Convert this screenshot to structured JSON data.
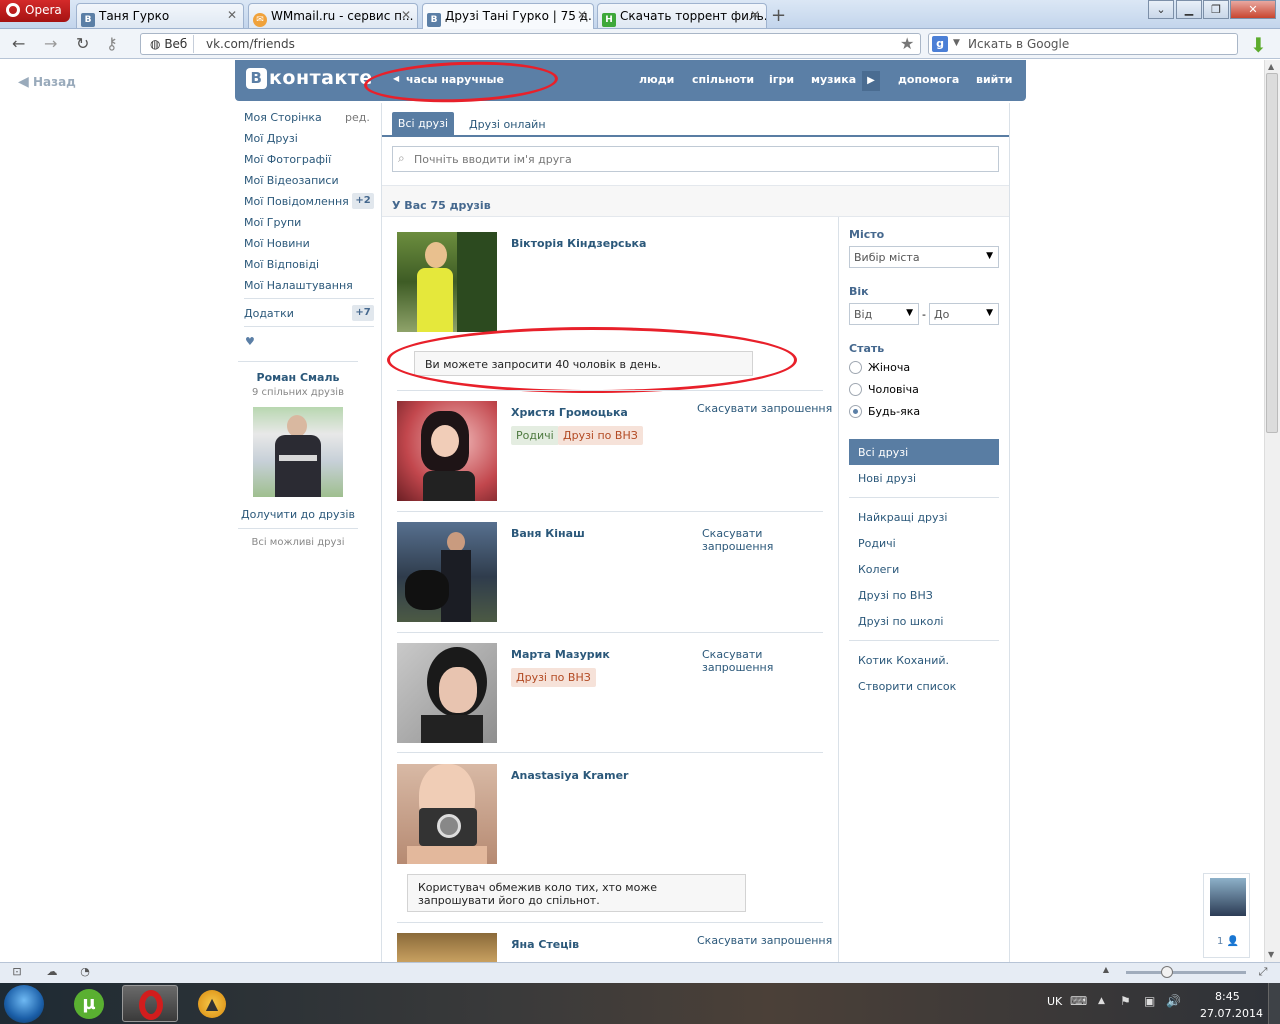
{
  "browser": {
    "menu_label": "Opera",
    "tabs": [
      {
        "title": "Таня Гурко",
        "favicon": "В"
      },
      {
        "title": "WMmail.ru - сервис п...",
        "favicon": "✉"
      },
      {
        "title": "Друзі Тані Гурко | 75 д...",
        "favicon": "В"
      },
      {
        "title": "Скачать торрент филь...",
        "favicon": "Н"
      }
    ],
    "web_badge": "Веб",
    "url": "vk.com/friends",
    "search_placeholder": "Искать в Google",
    "search_engine_icon": "g"
  },
  "page": {
    "back_label": "Назад",
    "header": {
      "logo_badge": "В",
      "logo_text": "контакте",
      "status": "часы наручные",
      "nav": [
        "люди",
        "спільноти",
        "ігри",
        "музика",
        "допомога",
        "вийти"
      ]
    },
    "left_menu": {
      "items": [
        {
          "label": "Моя Сторінка",
          "extra": "ред."
        },
        {
          "label": "Мої Друзі"
        },
        {
          "label": "Мої Фотографії"
        },
        {
          "label": "Мої Відеозаписи"
        },
        {
          "label": "Мої Повідомлення",
          "count": "+2"
        },
        {
          "label": "Мої Групи"
        },
        {
          "label": "Мої Новини"
        },
        {
          "label": "Мої Відповіді"
        },
        {
          "label": "Мої Налаштування"
        }
      ],
      "apps": {
        "label": "Додатки",
        "count": "+7"
      },
      "heart": "♥",
      "suggestion": {
        "name": "Роман Смаль",
        "mutual": "9 спільних друзів",
        "add_label": "Долучити до друзів",
        "all_label": "Всі можливі друзі"
      }
    },
    "tabs": {
      "all": "Всі друзі",
      "online": "Друзі онлайн"
    },
    "search_placeholder": "Почніть вводити ім'я друга",
    "friends_count": "У Вас 75 друзів",
    "friends": [
      {
        "name": "Вікторія Кіндзерська",
        "action": "",
        "tags": []
      },
      {
        "name": "Христя Громоцька",
        "action": "Скасувати запрошення",
        "tags": [
          {
            "label": "Родичі",
            "color": "green"
          },
          {
            "label": "Друзі по ВНЗ",
            "color": "orange"
          }
        ]
      },
      {
        "name": "Ваня Кінаш",
        "action": "Скасувати запрошення",
        "tags": []
      },
      {
        "name": "Марта Мазурик",
        "action": "Скасувати запрошення",
        "tags": [
          {
            "label": "Друзі по ВНЗ",
            "color": "orange"
          }
        ]
      },
      {
        "name": "Anastasiya Kramer",
        "action": "",
        "tags": []
      },
      {
        "name": "Яна Стецiв",
        "action": "Скасувати запрошення",
        "tags": []
      }
    ],
    "notice_limit": "Ви можете запросити 40 чоловік в день.",
    "notice_restricted": "Користувач обмежив коло тих, хто може запрошувати його до спільнот.",
    "filters": {
      "city_label": "Місто",
      "city_value": "Вибір міста",
      "age_label": "Вік",
      "age_from": "Від",
      "age_dash": "-",
      "age_to": "До",
      "sex_label": "Стать",
      "sex_options": [
        "Жіноча",
        "Чоловіча",
        "Будь-яка"
      ],
      "sex_selected": "Будь-яка",
      "lists_primary": [
        "Всі друзі",
        "Нові друзі"
      ],
      "lists_groups": [
        "Найкращі друзі",
        "Родичі",
        "Колеги",
        "Друзі по ВНЗ",
        "Друзі по школі"
      ],
      "lists_custom": [
        "Котик Коханий.",
        "Створити список"
      ]
    },
    "mini_chat_count": "1"
  },
  "taskbar": {
    "language": "UK",
    "time": "8:45",
    "date": "27.07.2014"
  },
  "colors": {
    "vk_blue": "#5b7fa6",
    "link": "#2b587a",
    "annotation_red": "#e8202a"
  }
}
